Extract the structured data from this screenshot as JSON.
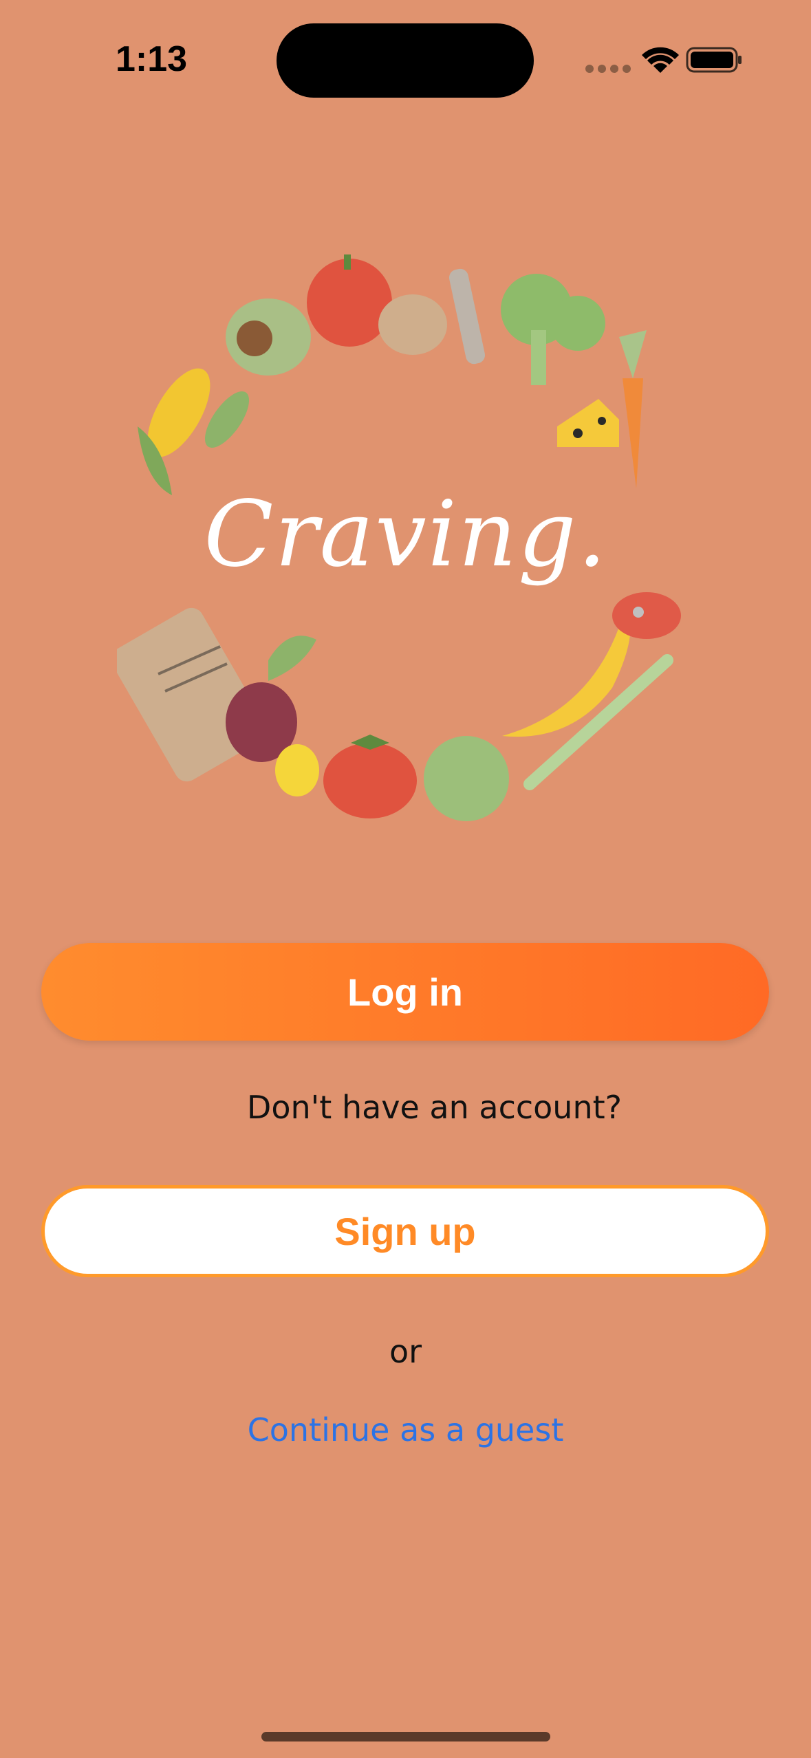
{
  "status_bar": {
    "time": "1:13"
  },
  "app": {
    "logo_text": "Craving."
  },
  "buttons": {
    "login_label": "Log in",
    "signup_label": "Sign up"
  },
  "texts": {
    "no_account_prompt": "Don't have an account?",
    "or_label": "or",
    "guest_link": "Continue as a guest"
  },
  "colors": {
    "background": "#E0936F",
    "login_gradient_start": "#FF8C2E",
    "login_gradient_end": "#FF6A25",
    "signup_text": "#FF8A26",
    "link": "#2C73E5"
  },
  "icons": [
    "signal-dots-icon",
    "wifi-icon",
    "battery-icon"
  ]
}
